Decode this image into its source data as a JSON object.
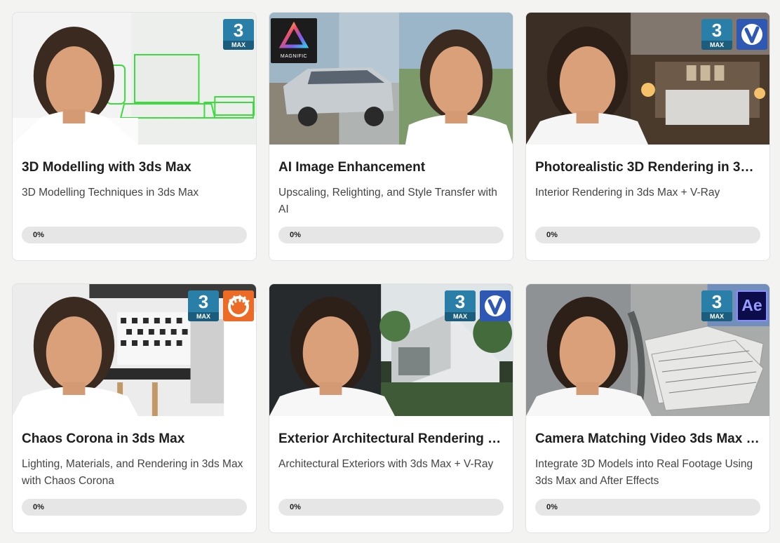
{
  "courses": [
    {
      "title": "3D Modelling with 3ds Max",
      "subtitle": "3D Modelling Techniques in 3ds Max",
      "progress_label": "0%",
      "progress": 0,
      "badges": [
        "3ds-max-icon"
      ],
      "badge_text": {
        "max_num": "3",
        "max_label": "MAX"
      }
    },
    {
      "title": "AI Image Enhancement",
      "subtitle": "Upscaling, Relighting, and Style Transfer with AI",
      "progress_label": "0%",
      "progress": 0,
      "badges": [
        "magnific-icon"
      ],
      "badge_text": {
        "magnific_label": "MAGNIFIC"
      }
    },
    {
      "title": "Photorealistic 3D Rendering in 3d…",
      "subtitle": "Interior Rendering in 3ds Max + V-Ray",
      "progress_label": "0%",
      "progress": 0,
      "badges": [
        "3ds-max-icon",
        "vray-icon"
      ],
      "badge_text": {
        "max_num": "3",
        "max_label": "MAX"
      }
    },
    {
      "title": "Chaos Corona in 3ds Max",
      "subtitle": "Lighting, Materials, and Rendering in 3ds Max with Chaos Corona",
      "progress_label": "0%",
      "progress": 0,
      "badges": [
        "3ds-max-icon",
        "corona-icon"
      ],
      "badge_text": {
        "max_num": "3",
        "max_label": "MAX"
      }
    },
    {
      "title": "Exterior Architectural Rendering 3…",
      "subtitle": "Architectural Exteriors with 3ds Max + V-Ray",
      "progress_label": "0%",
      "progress": 0,
      "badges": [
        "3ds-max-icon",
        "vray-icon"
      ],
      "badge_text": {
        "max_num": "3",
        "max_label": "MAX"
      }
    },
    {
      "title": "Camera Matching Video 3ds Max …",
      "subtitle": "Integrate 3D Models into Real Footage Using 3ds Max and After Effects",
      "progress_label": "0%",
      "progress": 0,
      "badges": [
        "3ds-max-icon",
        "after-effects-icon"
      ],
      "badge_text": {
        "max_num": "3",
        "max_label": "MAX",
        "ae_label": "Ae"
      }
    }
  ],
  "colors": {
    "page_bg": "#f3f3f2",
    "progress_track": "#e6e6e6",
    "max_badge": "#2a7fa8",
    "vray_badge": "#2f58b5",
    "corona_badge": "#ec6b26",
    "ae_badge": "#0c0c4a"
  }
}
